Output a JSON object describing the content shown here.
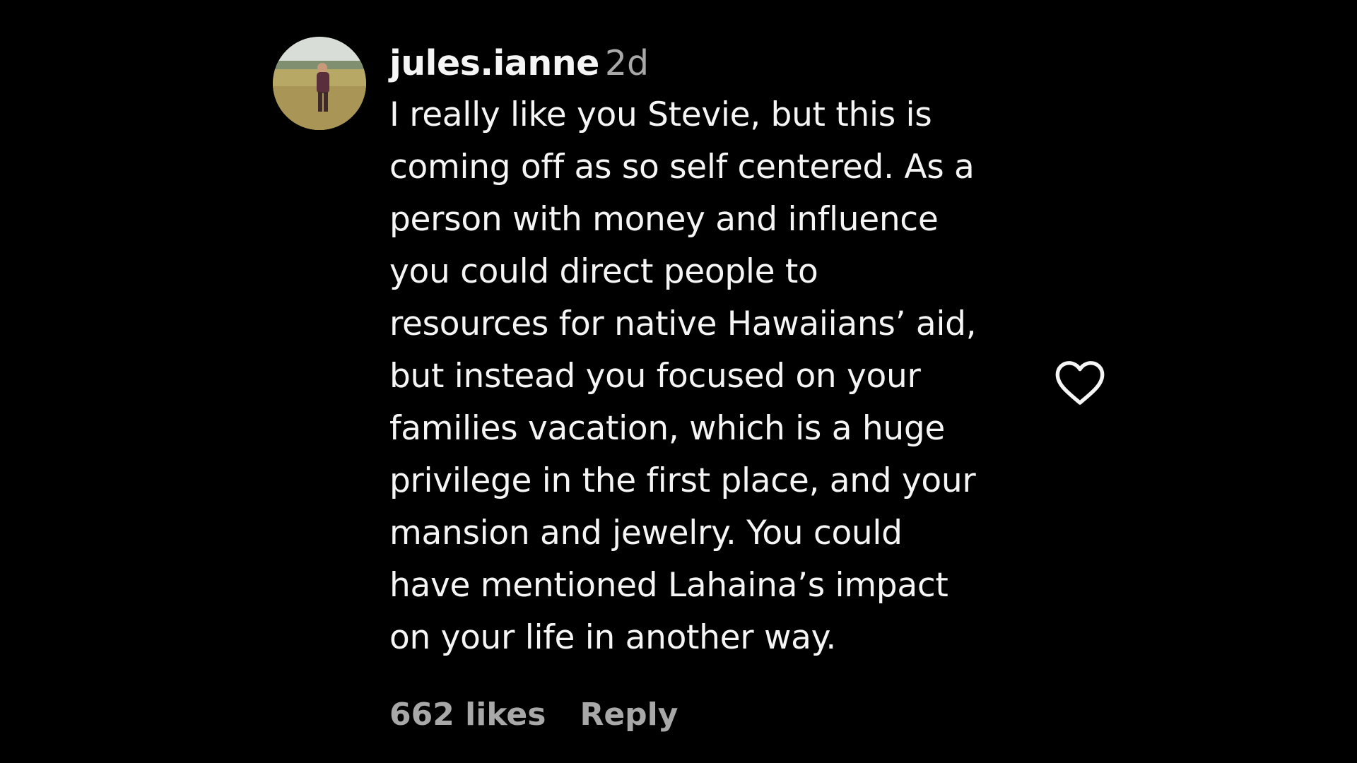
{
  "comment": {
    "username": "jules.ianne",
    "timestamp": "2d",
    "lines": [
      "I really like you Stevie, but this is",
      "coming off as so self centered. As a",
      "person with money and influence",
      "you could direct people to",
      "resources for native Hawaiians’ aid,",
      "but instead you focused on your",
      "families vacation, which is a huge",
      "privilege in the first place, and your",
      "mansion and jewelry. You could",
      "have mentioned Lahaina’s impact",
      "on your life in another way."
    ],
    "likes": "662 likes",
    "reply_label": "Reply",
    "like_icon": "heart-outline-icon"
  },
  "colors": {
    "background": "#000000",
    "primary_text": "#f5f5f5",
    "secondary_text": "#a8a8a8"
  }
}
